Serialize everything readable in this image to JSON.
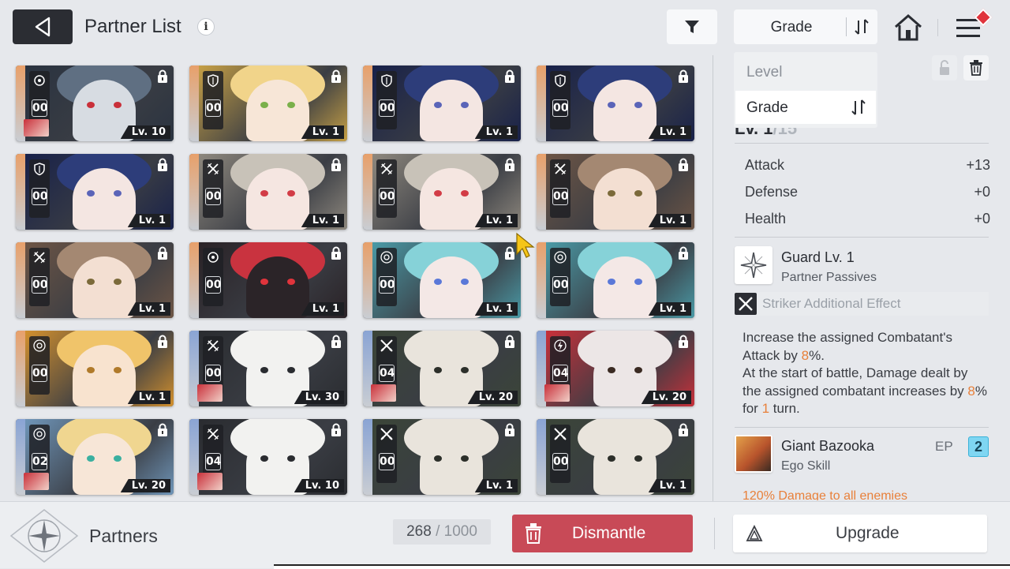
{
  "header": {
    "title": "Partner List",
    "info_glyph": "i",
    "sort_label": "Grade"
  },
  "dropdown": {
    "options": [
      "Level",
      "Grade"
    ],
    "selected": "Grade"
  },
  "cards": [
    {
      "count": "00",
      "level": "Lv. 10",
      "class": "support",
      "palette": "slate"
    },
    {
      "count": "00",
      "level": "Lv. 1",
      "class": "defender",
      "palette": "blonde"
    },
    {
      "count": "00",
      "level": "Lv. 1",
      "class": "defender",
      "palette": "navy"
    },
    {
      "count": "00",
      "level": "Lv. 1",
      "class": "defender",
      "palette": "navy"
    },
    {
      "count": "00",
      "level": "Lv. 1",
      "class": "defender",
      "palette": "navy"
    },
    {
      "count": "00",
      "level": "Lv. 1",
      "class": "striker",
      "palette": "silver"
    },
    {
      "count": "00",
      "level": "Lv. 1",
      "class": "striker",
      "palette": "silver"
    },
    {
      "count": "00",
      "level": "Lv. 1",
      "class": "striker",
      "palette": "brown"
    },
    {
      "count": "00",
      "level": "Lv. 1",
      "class": "striker",
      "palette": "brown"
    },
    {
      "count": "00",
      "level": "Lv. 1",
      "class": "support",
      "palette": "mascot"
    },
    {
      "count": "00",
      "level": "Lv. 1",
      "class": "ranger",
      "palette": "teal"
    },
    {
      "count": "00",
      "level": "Lv. 1",
      "class": "ranger",
      "palette": "teal"
    },
    {
      "count": "00",
      "level": "Lv. 1",
      "class": "ranger",
      "palette": "gold"
    },
    {
      "count": "00",
      "level": "Lv. 30",
      "class": "striker",
      "palette": "bunny"
    },
    {
      "count": "04",
      "level": "Lv. 20",
      "class": "swords",
      "palette": "beast"
    },
    {
      "count": "04",
      "level": "Lv. 20",
      "class": "psionic",
      "palette": "white-red"
    },
    {
      "count": "02",
      "level": "Lv. 20",
      "class": "ranger",
      "palette": "blonde-blue"
    },
    {
      "count": "04",
      "level": "Lv. 10",
      "class": "striker",
      "palette": "bunny"
    },
    {
      "count": "00",
      "level": "Lv. 1",
      "class": "swords",
      "palette": "beast"
    },
    {
      "count": "00",
      "level": "Lv. 1",
      "class": "swords",
      "palette": "beast"
    }
  ],
  "detail": {
    "level_text": "Lv. 1",
    "level_max": "/15",
    "stats": [
      {
        "label": "Attack",
        "value": "+13"
      },
      {
        "label": "Defense",
        "value": "+0"
      },
      {
        "label": "Health",
        "value": "+0"
      }
    ],
    "passive": {
      "name": "Guard Lv. 1",
      "type": "Partner Passives"
    },
    "effect_title": "Striker Additional Effect",
    "desc_1a": "Increase the assigned Combatant's Attack by ",
    "desc_1b": "8",
    "desc_1c": "%.",
    "desc_2a": "At the start of battle, Damage dealt by the assigned combatant increases by ",
    "desc_2b": "8",
    "desc_2c": "% for ",
    "desc_2d": "1",
    "desc_2e": " turn.",
    "ego": {
      "name": "Giant Bazooka",
      "type": "Ego Skill",
      "ep_label": "EP",
      "ep_value": "2"
    },
    "cut_text": "120% Damage to all enemies"
  },
  "footer": {
    "section": "Partners",
    "capacity_used": "268",
    "capacity_max": " / 1000",
    "dismantle": "Dismantle",
    "upgrade": "Upgrade"
  },
  "colors": {
    "accent_orange": "#e8803a",
    "dismantle_red": "#c84a57",
    "ep_blue": "#7fd6f2",
    "badge_red": "#e0343c"
  }
}
